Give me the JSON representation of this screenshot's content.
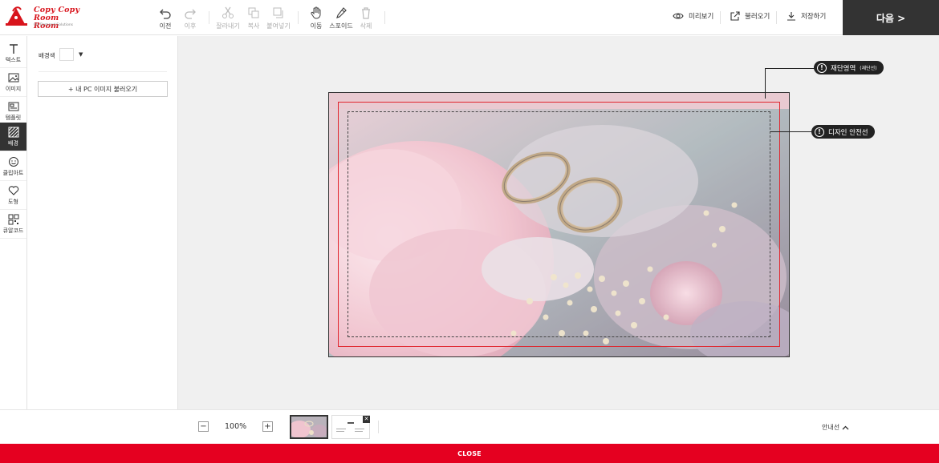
{
  "brand": {
    "line1": "Copy Copy",
    "line2": "Room Room",
    "tagline": "On Demand Solutions",
    "color": "#d8141c"
  },
  "toolbar": {
    "undo": "이전",
    "redo": "이후",
    "cut": "잘라내기",
    "copy": "복사",
    "paste": "붙여넣기",
    "move": "이동",
    "eyedropper": "스포이드",
    "delete": "삭제"
  },
  "actions": {
    "preview": "미리보기",
    "load": "불러오기",
    "save": "저장하기",
    "next": "다음 >"
  },
  "sidebar": {
    "items": [
      {
        "label": "텍스트",
        "icon": "text-icon"
      },
      {
        "label": "이미지",
        "icon": "image-icon"
      },
      {
        "label": "템플릿",
        "icon": "template-icon"
      },
      {
        "label": "배경",
        "icon": "background-icon",
        "active": true
      },
      {
        "label": "클립아트",
        "icon": "smiley-icon"
      },
      {
        "label": "도형",
        "icon": "heart-icon"
      },
      {
        "label": "큐알코드",
        "icon": "qr-icon"
      }
    ]
  },
  "panel": {
    "bg_color_label": "배경색",
    "bg_color_value": "#ffffff",
    "upload_button": "+ 내 PC 이미지 불러오기"
  },
  "canvas": {
    "cut_callout": "재단영역",
    "cut_callout_note": "(재단선)",
    "safe_callout": "디자인 안전선",
    "cut_line_color": "#e0242c"
  },
  "bottom": {
    "zoom_out": "−",
    "zoom_level": "100%",
    "zoom_in": "+",
    "page_delete": "✕",
    "guide_toggle": "안내선",
    "close": "CLOSE",
    "close_color": "#e50020"
  }
}
